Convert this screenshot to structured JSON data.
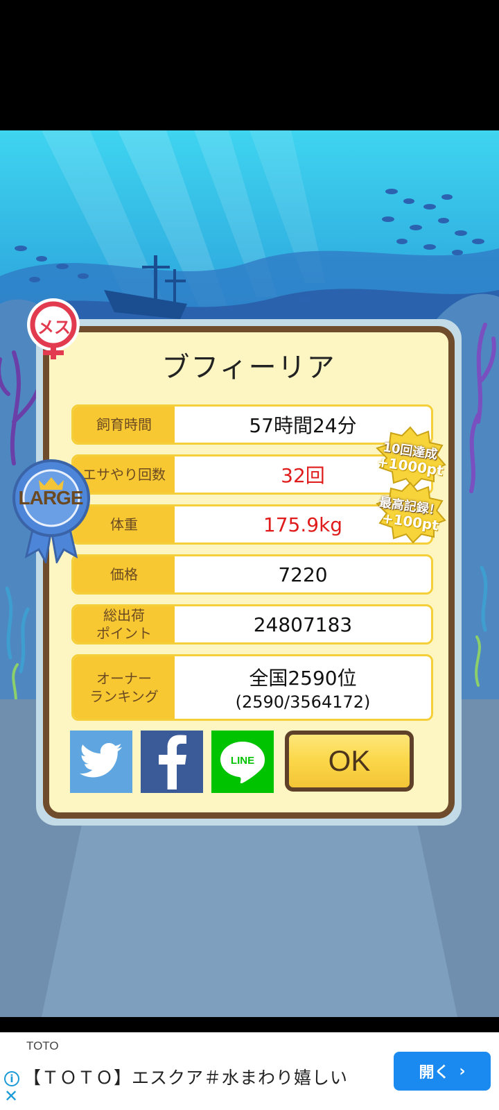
{
  "fish": {
    "name": "ブフィーリア",
    "gender_label": "メス",
    "size_label": "LARGE"
  },
  "stats": [
    {
      "label": "飼育時間",
      "value": "57時間24分",
      "highlight": false
    },
    {
      "label": "エサやり回数",
      "value": "32回",
      "highlight": true
    },
    {
      "label": "体重",
      "value": "175.9kg",
      "highlight": true
    },
    {
      "label": "価格",
      "value": "7220",
      "highlight": false
    },
    {
      "label": "総出荷\nポイント",
      "value": "24807183",
      "highlight": false
    },
    {
      "label": "オーナー\nランキング",
      "value": "全国2590位",
      "sub": "(2590/3564172)",
      "highlight": false
    }
  ],
  "bonuses": [
    {
      "line1": "10回達成",
      "line2": "+1000pt"
    },
    {
      "line1": "最高記録！",
      "line2": "+100pt"
    }
  ],
  "buttons": {
    "ok": "OK",
    "line": "LINE"
  },
  "ad": {
    "brand": "TOTO",
    "text": "【ＴＯＴＯ】エスクア＃水まわり嬉しい",
    "button_label": "開く",
    "button_arrow": "›"
  },
  "colors": {
    "label_bg": "#f7c832",
    "highlight_text": "#e01b1b",
    "frame": "#6e4c2c",
    "panel_bg": "#fdf6c2",
    "twitter": "#5fa6e1",
    "facebook": "#3b5a98",
    "line": "#00c300",
    "ad_button": "#1a8af0"
  }
}
